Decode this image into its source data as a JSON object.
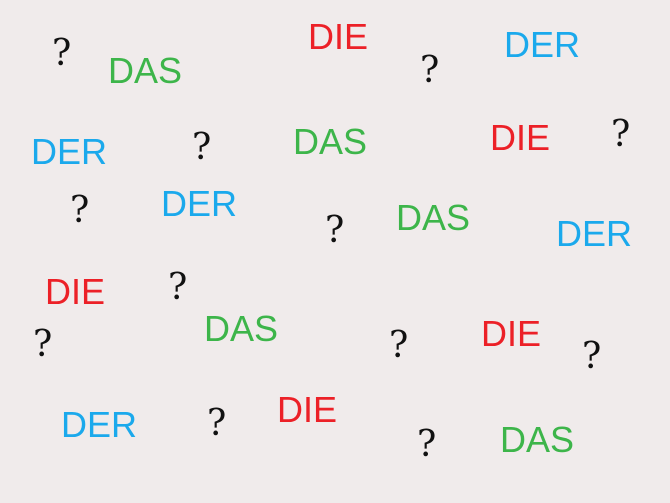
{
  "colors": {
    "die": "#ec2027",
    "der": "#1ba9ec",
    "das": "#3db54a",
    "question": "#111111",
    "background": "#f0ebeb"
  },
  "words": [
    {
      "text": "DAS",
      "article": "das"
    },
    {
      "text": "DIE",
      "article": "die"
    },
    {
      "text": "DER",
      "article": "der"
    },
    {
      "text": "DER",
      "article": "der"
    },
    {
      "text": "DAS",
      "article": "das"
    },
    {
      "text": "DIE",
      "article": "die"
    },
    {
      "text": "DER",
      "article": "der"
    },
    {
      "text": "DAS",
      "article": "das"
    },
    {
      "text": "DER",
      "article": "der"
    },
    {
      "text": "DIE",
      "article": "die"
    },
    {
      "text": "DAS",
      "article": "das"
    },
    {
      "text": "DIE",
      "article": "die"
    },
    {
      "text": "DER",
      "article": "der"
    },
    {
      "text": "DIE",
      "article": "die"
    },
    {
      "text": "DAS",
      "article": "das"
    }
  ],
  "question_marks": [
    "?",
    "?",
    "?",
    "?",
    "?",
    "?",
    "?",
    "?",
    "?",
    "?",
    "?",
    "?"
  ]
}
